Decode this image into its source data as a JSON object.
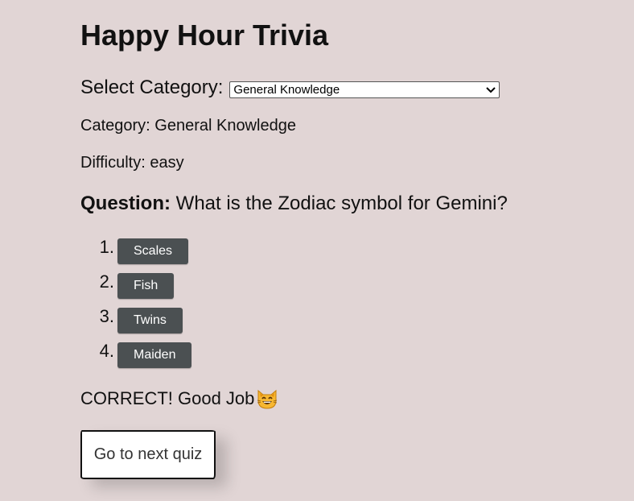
{
  "page": {
    "title": "Happy Hour Trivia"
  },
  "category_select": {
    "label": "Select Category:",
    "selected": "General Knowledge"
  },
  "quiz": {
    "category_line": "Category: General Knowledge",
    "difficulty_line": "Difficulty: easy",
    "question_label": "Question:",
    "question_text": "What is the Zodiac symbol for Gemini?",
    "answers": [
      {
        "number": "1.",
        "label": "Scales"
      },
      {
        "number": "2.",
        "label": "Fish"
      },
      {
        "number": "3.",
        "label": "Twins"
      },
      {
        "number": "4.",
        "label": "Maiden"
      }
    ]
  },
  "result": {
    "text": "CORRECT! Good Job",
    "icon": "grinning-cat-emoji"
  },
  "next_button": {
    "label": "Go to next quiz"
  },
  "colors": {
    "background": "#e1d5d5",
    "answer_button": "#4b5052"
  }
}
